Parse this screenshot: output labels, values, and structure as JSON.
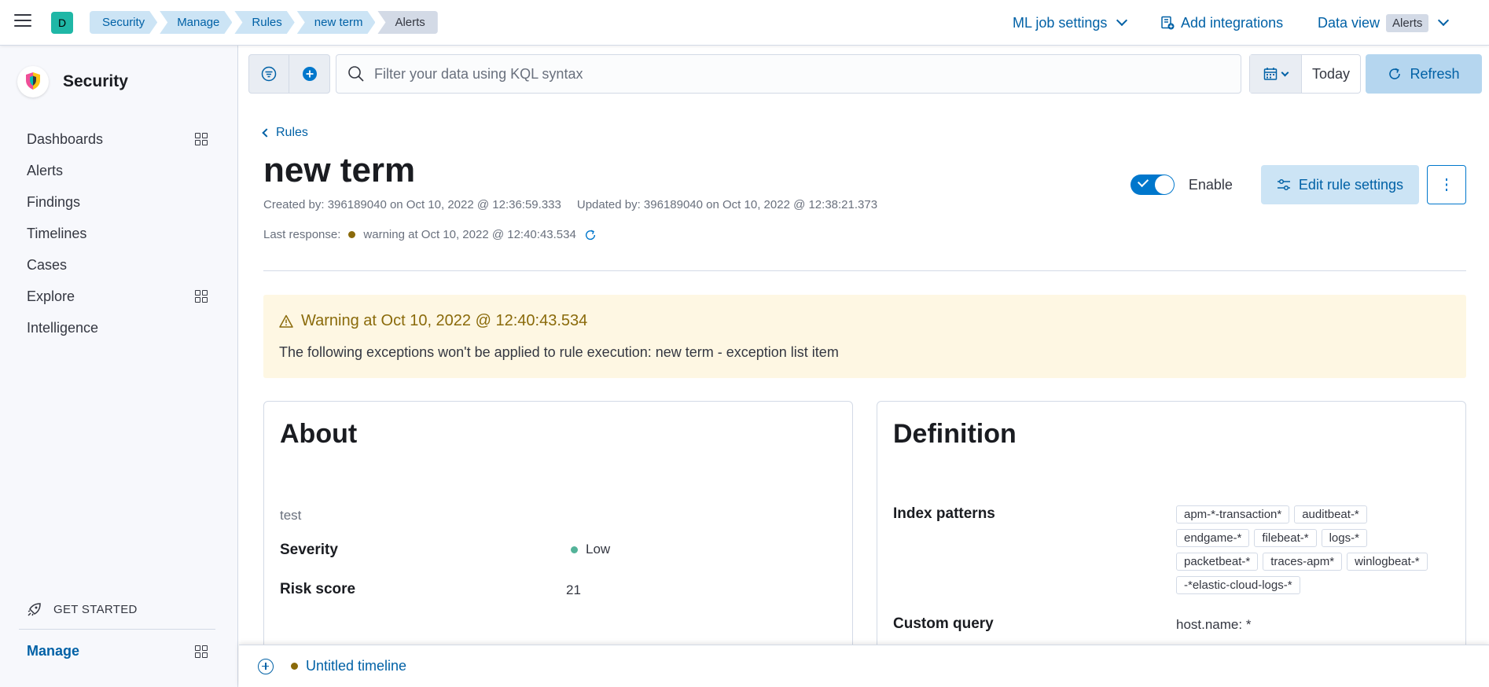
{
  "topbar": {
    "space_initial": "D",
    "breadcrumbs": [
      "Security",
      "Manage",
      "Rules",
      "new term",
      "Alerts"
    ],
    "ml_job_settings": "ML job settings",
    "add_integrations": "Add integrations",
    "data_view_label": "Data view",
    "data_view_value": "Alerts"
  },
  "sidebar": {
    "title": "Security",
    "items": [
      {
        "label": "Dashboards",
        "icon": "apps-grid-icon"
      },
      {
        "label": "Alerts"
      },
      {
        "label": "Findings"
      },
      {
        "label": "Timelines"
      },
      {
        "label": "Cases"
      },
      {
        "label": "Explore",
        "icon": "apps-grid-icon"
      },
      {
        "label": "Intelligence"
      }
    ],
    "get_started": "GET STARTED",
    "manage": "Manage"
  },
  "querybar": {
    "placeholder": "Filter your data using KQL syntax",
    "date": "Today",
    "refresh": "Refresh"
  },
  "rule": {
    "back": "Rules",
    "title": "new term",
    "created": "Created by: 396189040 on Oct 10, 2022 @ 12:36:59.333",
    "updated": "Updated by: 396189040 on Oct 10, 2022 @ 12:38:21.373",
    "last_response_label": "Last response:",
    "last_response_value": "warning at Oct 10, 2022 @ 12:40:43.534",
    "status_color": "#8a6a0a",
    "enable_label": "Enable",
    "enabled": true,
    "edit_button": "Edit rule settings"
  },
  "warning": {
    "title": "Warning at Oct 10, 2022 @ 12:40:43.534",
    "body": "The following exceptions won't be applied to rule execution: new term - exception list item"
  },
  "about": {
    "heading": "About",
    "description": "test",
    "severity_label": "Severity",
    "severity_value": "Low",
    "severity_color": "#54b399",
    "risk_label": "Risk score",
    "risk_value": "21"
  },
  "definition": {
    "heading": "Definition",
    "index_label": "Index patterns",
    "index_patterns": [
      "apm-*-transaction*",
      "auditbeat-*",
      "endgame-*",
      "filebeat-*",
      "logs-*",
      "packetbeat-*",
      "traces-apm*",
      "winlogbeat-*",
      "-*elastic-cloud-logs-*"
    ],
    "query_label": "Custom query",
    "query_value": "host.name: *"
  },
  "timeline": {
    "name": "Untitled timeline",
    "dot_color": "#8a6a0a"
  }
}
